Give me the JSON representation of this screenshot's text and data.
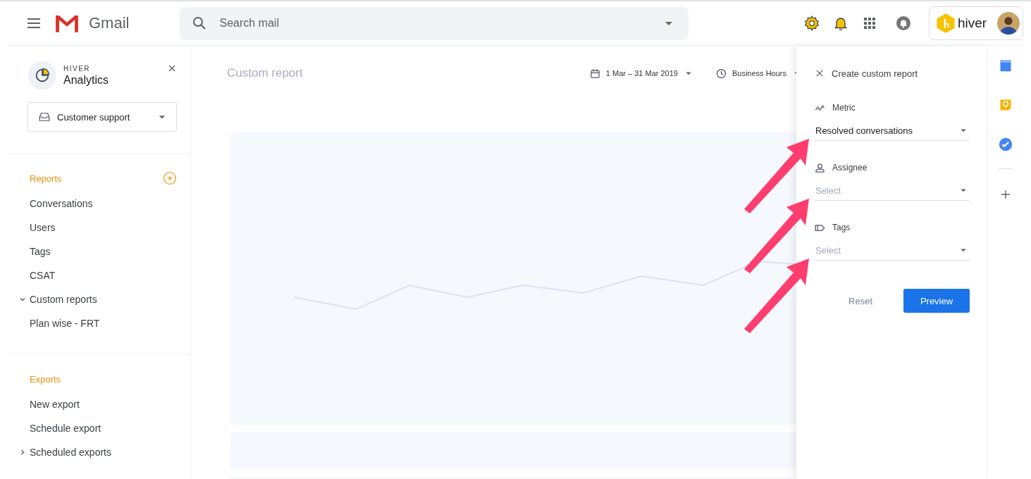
{
  "header": {
    "app_name": "Gmail",
    "search": {
      "placeholder": "Search mail"
    },
    "account": {
      "brand": "hiver"
    }
  },
  "sidebar": {
    "overline": "HIVER",
    "title": "Analytics",
    "inbox_select": {
      "value": "Customer support"
    },
    "sections": [
      {
        "heading": "Reports",
        "add_button": true,
        "items": [
          {
            "kind": "link",
            "label": "Conversations"
          },
          {
            "kind": "link",
            "label": "Users"
          },
          {
            "kind": "link",
            "label": "Tags"
          },
          {
            "kind": "link",
            "label": "CSAT"
          },
          {
            "kind": "folder",
            "label": "Custom reports",
            "expanded": true,
            "children": [
              {
                "kind": "link",
                "label": "Plan wise - FRT"
              }
            ]
          }
        ]
      },
      {
        "heading": "Exports",
        "add_button": false,
        "items": [
          {
            "kind": "link",
            "label": "New export"
          },
          {
            "kind": "link",
            "label": "Schedule export"
          },
          {
            "kind": "folder",
            "label": "Scheduled exports",
            "expanded": false
          }
        ]
      }
    ]
  },
  "main": {
    "title": "Custom report",
    "filters": [
      {
        "kind": "date",
        "value": "1 Mar – 31 Mar 2019"
      },
      {
        "kind": "hours",
        "value": "Business Hours"
      }
    ]
  },
  "panel": {
    "title": "Create custom report",
    "fields": [
      {
        "kind": "metric",
        "label": "Metric",
        "value": "Resolved conversations"
      },
      {
        "kind": "person",
        "label": "Assignee",
        "placeholder": "Select"
      },
      {
        "kind": "tag",
        "label": "Tags",
        "placeholder": "Select"
      }
    ],
    "buttons": [
      {
        "kind": "text",
        "label": "Reset"
      },
      {
        "kind": "primary",
        "label": "Preview"
      }
    ]
  },
  "annotations": [
    {
      "kind": "arrow"
    },
    {
      "kind": "arrow"
    },
    {
      "kind": "arrow"
    }
  ]
}
